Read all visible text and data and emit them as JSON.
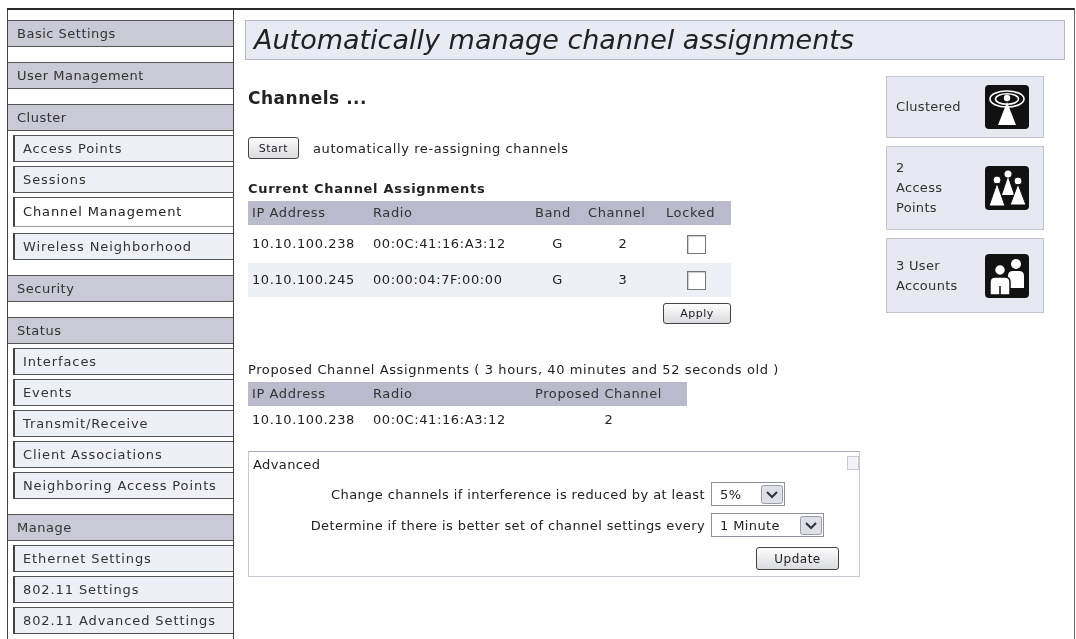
{
  "sidebar": {
    "groups": [
      {
        "label": "Basic Settings"
      },
      {
        "label": "User Management"
      },
      {
        "label": "Cluster",
        "items": [
          {
            "label": "Access Points",
            "selected": false
          },
          {
            "label": "Sessions",
            "selected": false
          },
          {
            "label": "Channel Management",
            "selected": true
          },
          {
            "label": "Wireless Neighborhood",
            "selected": false
          }
        ]
      },
      {
        "label": "Security"
      },
      {
        "label": "Status",
        "items": [
          {
            "label": "Interfaces",
            "selected": false
          },
          {
            "label": "Events",
            "selected": false
          },
          {
            "label": "Transmit/Receive",
            "selected": false
          },
          {
            "label": "Client Associations",
            "selected": false
          },
          {
            "label": "Neighboring Access Points",
            "selected": false
          }
        ]
      },
      {
        "label": "Manage",
        "items": [
          {
            "label": "Ethernet Settings",
            "selected": false
          },
          {
            "label": "802.11 Settings",
            "selected": false
          },
          {
            "label": "802.11 Advanced Settings",
            "selected": false
          }
        ]
      }
    ]
  },
  "header": {
    "title": "Automatically manage channel assignments"
  },
  "channels": {
    "heading": "Channels ...",
    "start_button": "Start",
    "start_caption": "automatically re-assigning channels"
  },
  "current_assignments": {
    "title": "Current Channel Assignments",
    "columns": [
      "IP Address",
      "Radio",
      "Band",
      "Channel",
      "Locked"
    ],
    "rows": [
      {
        "ip_address": "10.10.100.238",
        "radio": "00:0C:41:16:A3:12",
        "band": "G",
        "channel": "2",
        "locked": false
      },
      {
        "ip_address": "10.10.100.245",
        "radio": "00:00:04:7F:00:00",
        "band": "G",
        "channel": "3",
        "locked": false
      }
    ],
    "apply_button": "Apply"
  },
  "proposed_assignments": {
    "title": "Proposed Channel Assignments ( 3 hours, 40 minutes and 52 seconds old )",
    "columns": [
      "IP Address",
      "Radio",
      "Proposed Channel"
    ],
    "rows": [
      {
        "ip_address": "10.10.100.238",
        "radio": "00:0C:41:16:A3:12",
        "proposed_channel": "2"
      }
    ]
  },
  "advanced": {
    "title": "Advanced",
    "settings": [
      {
        "label": "Change channels if interference is reduced by at least",
        "value": "5%"
      },
      {
        "label": "Determine if there is better set of channel settings every",
        "value": "1 Minute"
      }
    ],
    "update_button": "Update"
  },
  "status_cards": [
    {
      "kind": "cluster",
      "lines": [
        "Clustered"
      ]
    },
    {
      "kind": "access_points",
      "lines": [
        "2",
        "Access",
        "Points"
      ]
    },
    {
      "kind": "users",
      "lines": [
        "3 User",
        "Accounts"
      ]
    }
  ]
}
